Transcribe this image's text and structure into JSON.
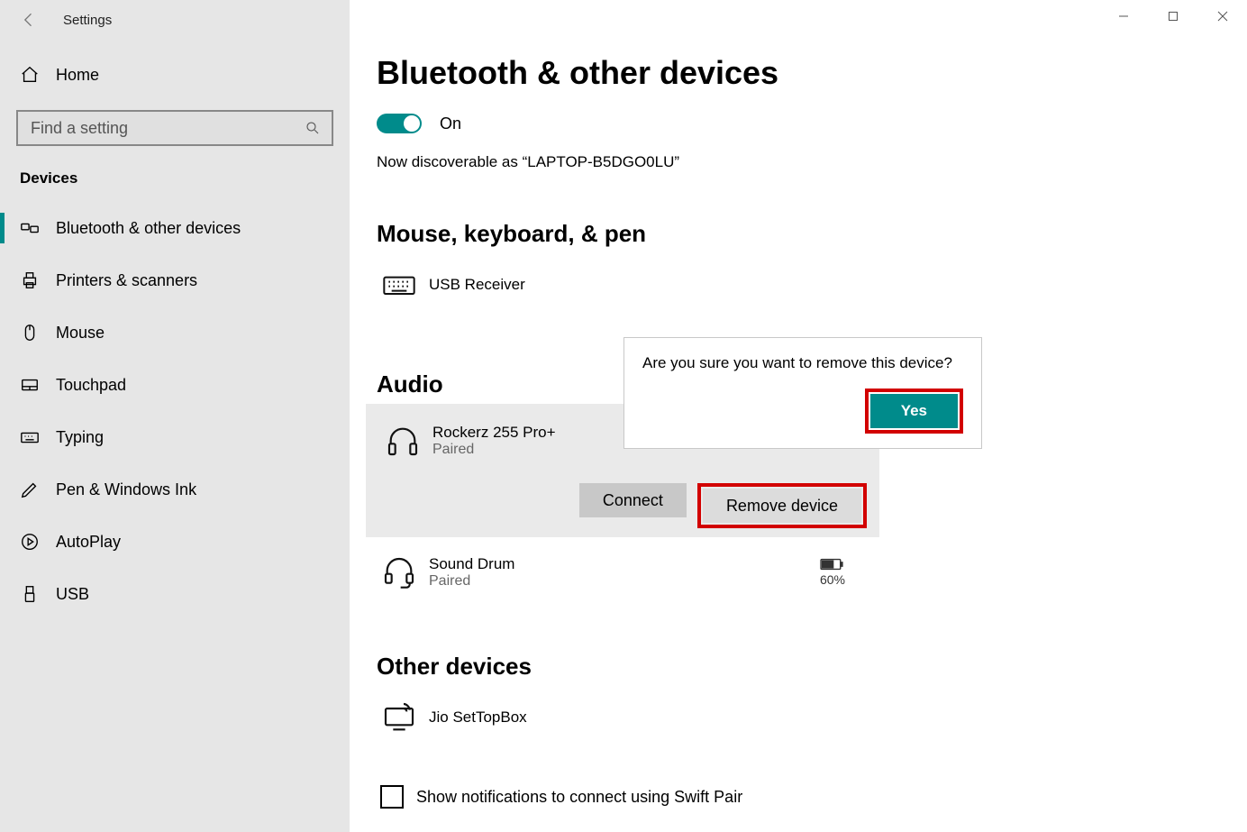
{
  "window": {
    "app_title": "Settings"
  },
  "sidebar": {
    "home_label": "Home",
    "search_placeholder": "Find a setting",
    "category": "Devices",
    "items": [
      {
        "icon": "bluetooth",
        "label": "Bluetooth & other devices"
      },
      {
        "icon": "printer",
        "label": "Printers & scanners"
      },
      {
        "icon": "mouse",
        "label": "Mouse"
      },
      {
        "icon": "touchpad",
        "label": "Touchpad"
      },
      {
        "icon": "typing",
        "label": "Typing"
      },
      {
        "icon": "pen",
        "label": "Pen & Windows Ink"
      },
      {
        "icon": "autoplay",
        "label": "AutoPlay"
      },
      {
        "icon": "usb",
        "label": "USB"
      }
    ]
  },
  "main": {
    "page_title": "Bluetooth & other devices",
    "toggle_label": "On",
    "discoverable_text": "Now discoverable as “LAPTOP-B5DGO0LU”",
    "sections": {
      "mouse": {
        "title": "Mouse, keyboard, & pen",
        "devices": [
          {
            "name": "USB Receiver"
          }
        ]
      },
      "audio": {
        "title": "Audio",
        "devices": [
          {
            "name": "Rockerz 255 Pro+",
            "status": "Paired"
          },
          {
            "name": "Sound Drum",
            "status": "Paired",
            "battery": "60%"
          }
        ]
      },
      "other": {
        "title": "Other devices",
        "devices": [
          {
            "name": "Jio SetTopBox"
          }
        ]
      }
    },
    "actions": {
      "connect": "Connect",
      "remove": "Remove device"
    },
    "popup": {
      "text": "Are you sure you want to remove this device?",
      "confirm": "Yes"
    },
    "swift_pair_label": "Show notifications to connect using Swift Pair"
  }
}
